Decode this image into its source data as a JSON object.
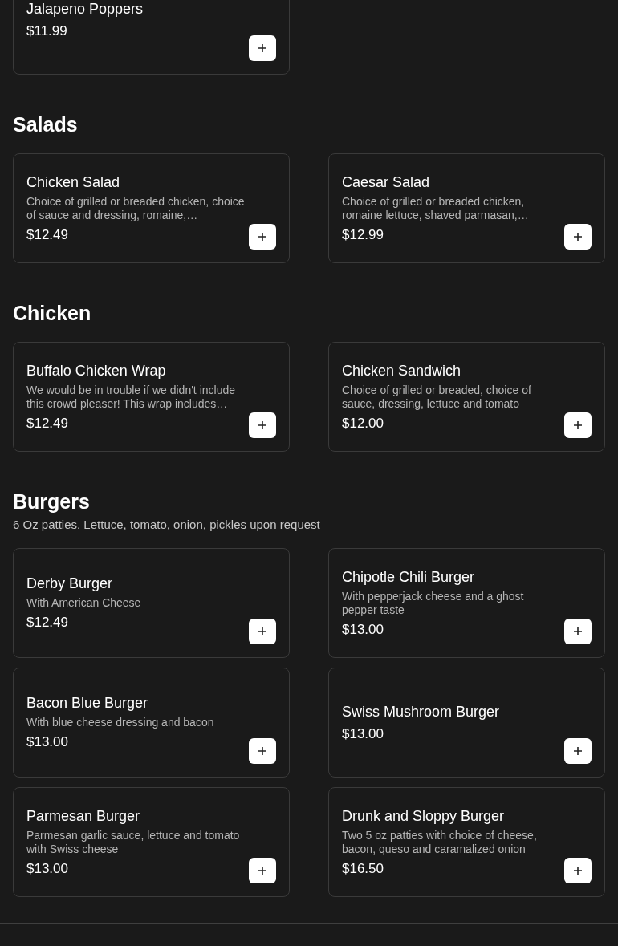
{
  "sections": [
    {
      "items": [
        {
          "name": "Jalapeno Poppers",
          "price": "$11.99"
        }
      ]
    },
    {
      "title": "Salads",
      "items": [
        {
          "name": "Chicken Salad",
          "description": "Choice of grilled or breaded chicken, choice of sauce and dressing, romaine,…",
          "price": "$12.49"
        },
        {
          "name": "Caesar Salad",
          "description": "Choice of grilled or breaded chicken, romaine lettuce, shaved parmasan,…",
          "price": "$12.99"
        }
      ]
    },
    {
      "title": "Chicken",
      "items": [
        {
          "name": "Buffalo Chicken Wrap",
          "description": "We would be in trouble if we didn't include this crowd pleaser! This wrap includes…",
          "price": "$12.49"
        },
        {
          "name": "Chicken Sandwich",
          "description": "Choice of grilled or breaded, choice of sauce, dressing, lettuce and tomato",
          "price": "$12.00"
        }
      ]
    },
    {
      "title": "Burgers",
      "subtitle": "6 Oz patties. Lettuce, tomato, onion, pickles upon request",
      "items": [
        {
          "name": "Derby Burger",
          "description": "With American Cheese",
          "price": "$12.49"
        },
        {
          "name": "Chipotle Chili Burger",
          "description": "With pepperjack cheese and a ghost pepper taste",
          "price": "$13.00"
        },
        {
          "name": "Bacon Blue Burger",
          "description": "With blue cheese dressing and bacon",
          "price": "$13.00"
        },
        {
          "name": "Swiss Mushroom Burger",
          "price": "$13.00"
        },
        {
          "name": "Parmesan Burger",
          "description": "Parmesan garlic sauce, lettuce and tomato with Swiss cheese",
          "price": "$13.00"
        },
        {
          "name": "Drunk and Sloppy Burger",
          "description": "Two 5 oz patties with choice of cheese, bacon, queso and caramalized onion",
          "price": "$16.50"
        }
      ]
    }
  ]
}
